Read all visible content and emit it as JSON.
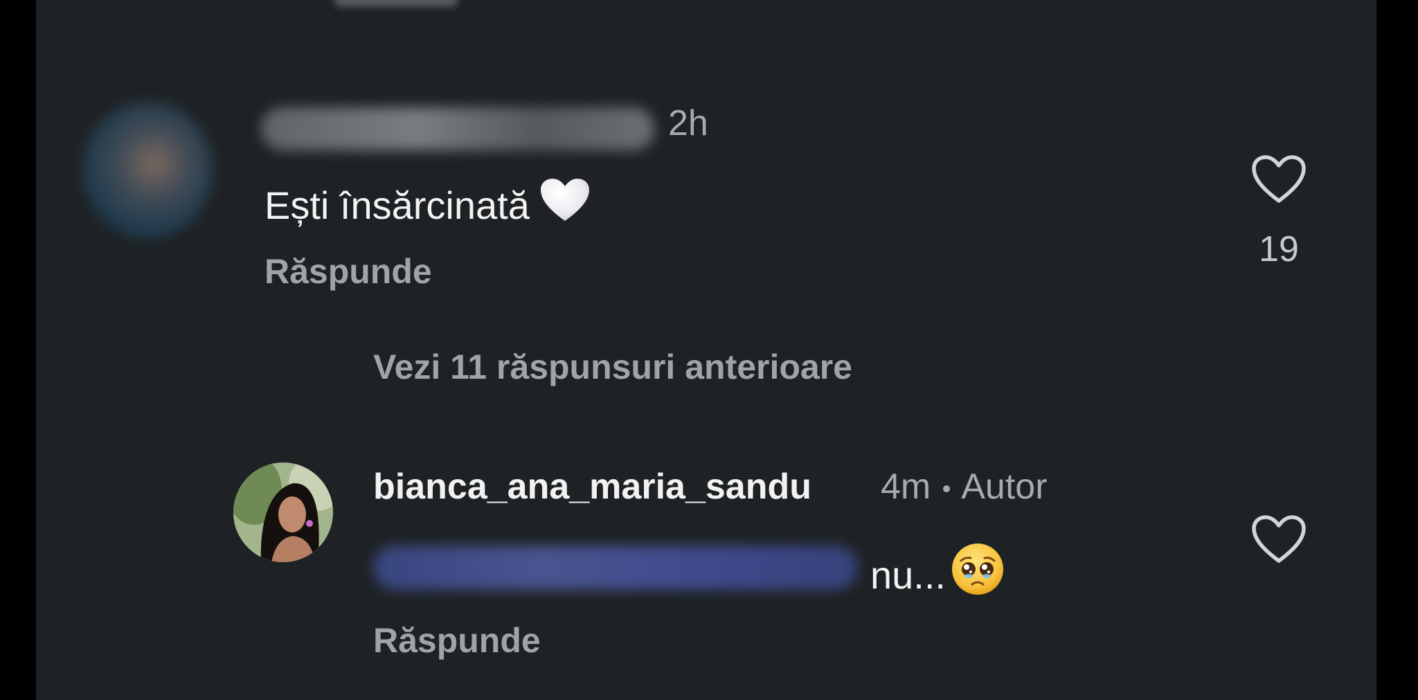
{
  "comments": [
    {
      "time": "2h",
      "text": "Ești însărcinată",
      "reaction_icon": "white-heart-emoji",
      "reply_label": "Răspunde",
      "likes": "19",
      "like_icon": "heart-outline-icon"
    }
  ],
  "view_replies": "Vezi 11 răspunsuri anterioare",
  "reply": {
    "username": "bianca_ana_maria_sandu",
    "time": "4m",
    "badge": "Autor",
    "text": "nu...",
    "emoji_icon": "pleading-face-emoji",
    "reply_label": "Răspunde",
    "like_icon": "heart-outline-icon"
  },
  "colors": {
    "background": "#1e2224",
    "primary_text": "#f4f4f4",
    "secondary_text": "#a7abae"
  }
}
